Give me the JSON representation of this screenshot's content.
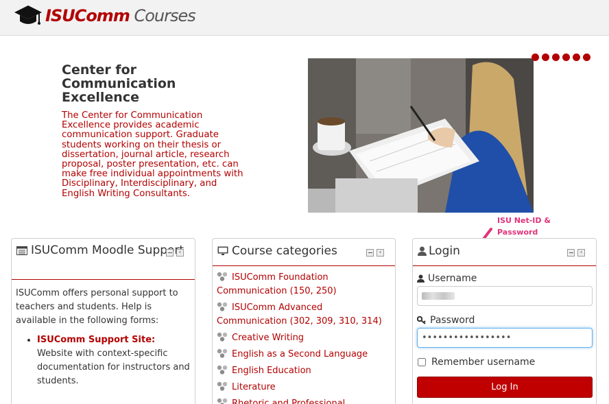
{
  "header": {
    "logo_brand": "ISUComm",
    "logo_rest": " Courses",
    "logo_icon": "graduation-cap-icon"
  },
  "hero": {
    "title": "Center for Communication Excellence",
    "description": "The Center for Communication Excellence provides academic communication support. Graduate students working on their thesis or dissertation, journal article, research proposal, poster presentation, etc. can make free individual appointments with Disciplinary, Interdisciplinary, and English Writing Consultants.",
    "slide_count": 6
  },
  "annotation": {
    "line1": "ISU Net-ID &",
    "line2": "Password",
    "color": "#e0337a"
  },
  "moodle_block": {
    "title": "ISUComm Moodle Support",
    "intro": "ISUComm offers personal support to teachers and students. Help is available in the following forms:",
    "items": [
      {
        "link": "ISUComm Support Site:",
        "text": " Website with context-specific documentation for instructors and students."
      }
    ]
  },
  "categories_block": {
    "title": "Course categories",
    "items": [
      {
        "label": "ISUComm Foundation Communication (150, 250)"
      },
      {
        "label": "ISUComm Advanced Communication (302, 309, 310, 314)"
      },
      {
        "label": "Creative Writing"
      },
      {
        "label": "English as a Second Language"
      },
      {
        "label": "English Education"
      },
      {
        "label": "Literature"
      },
      {
        "label": "Rhetoric and Professional"
      }
    ]
  },
  "login_block": {
    "title": "Login",
    "username_label": "Username",
    "password_label": "Password",
    "password_value": "•••••••••••••••••",
    "remember_label": "Remember username",
    "login_button": "Log In"
  },
  "colors": {
    "accent": "#b30000",
    "button": "#c00000",
    "topbar": "#f2f2f2"
  }
}
